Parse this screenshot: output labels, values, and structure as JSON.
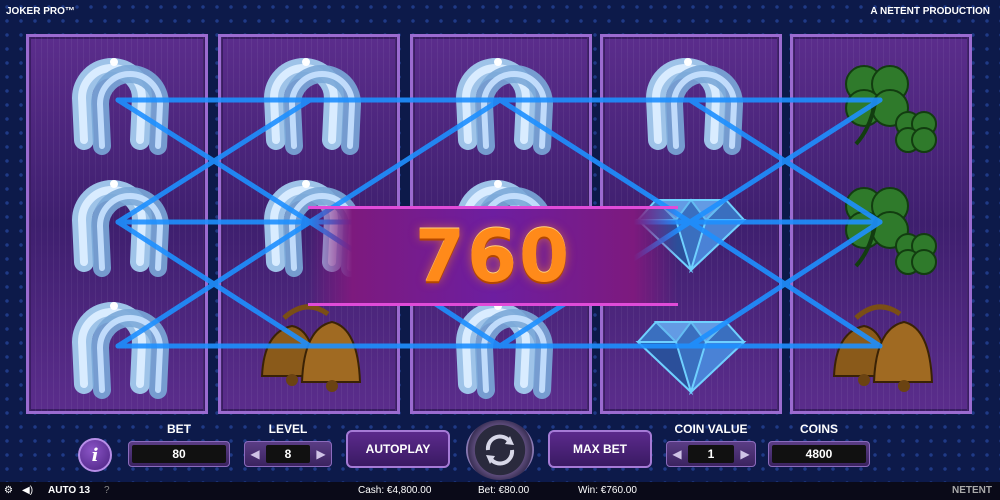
{
  "header": {
    "game_title": "JOKER PRO™",
    "producer": "A NETENT PRODUCTION"
  },
  "reels": [
    [
      "horseshoe",
      "horseshoe",
      "horseshoe"
    ],
    [
      "horseshoe",
      "horseshoe",
      "bell"
    ],
    [
      "horseshoe",
      "horseshoe",
      "horseshoe"
    ],
    [
      "horseshoe",
      "diamond",
      "diamond"
    ],
    [
      "clover",
      "clover",
      "bell"
    ]
  ],
  "win": {
    "amount": "760"
  },
  "controls": {
    "info_icon": "i",
    "bet_label": "BET",
    "bet_value": "80",
    "level_label": "LEVEL",
    "level_value": "8",
    "autoplay_label": "AUTOPLAY",
    "max_bet_label": "MAX BET",
    "coin_value_label": "COIN VALUE",
    "coin_value": "1",
    "coins_label": "COINS",
    "coins_value": "4800"
  },
  "status": {
    "auto_label": "AUTO 13",
    "help_icon": "?",
    "cash": "Cash: €4,800.00",
    "bet": "Bet: €80.00",
    "win": "Win: €760.00",
    "brand": "NETENT"
  },
  "colors": {
    "payline": "#1e90ff",
    "win_text": "#ff8a1a",
    "reel_bg": "#4a2478"
  }
}
